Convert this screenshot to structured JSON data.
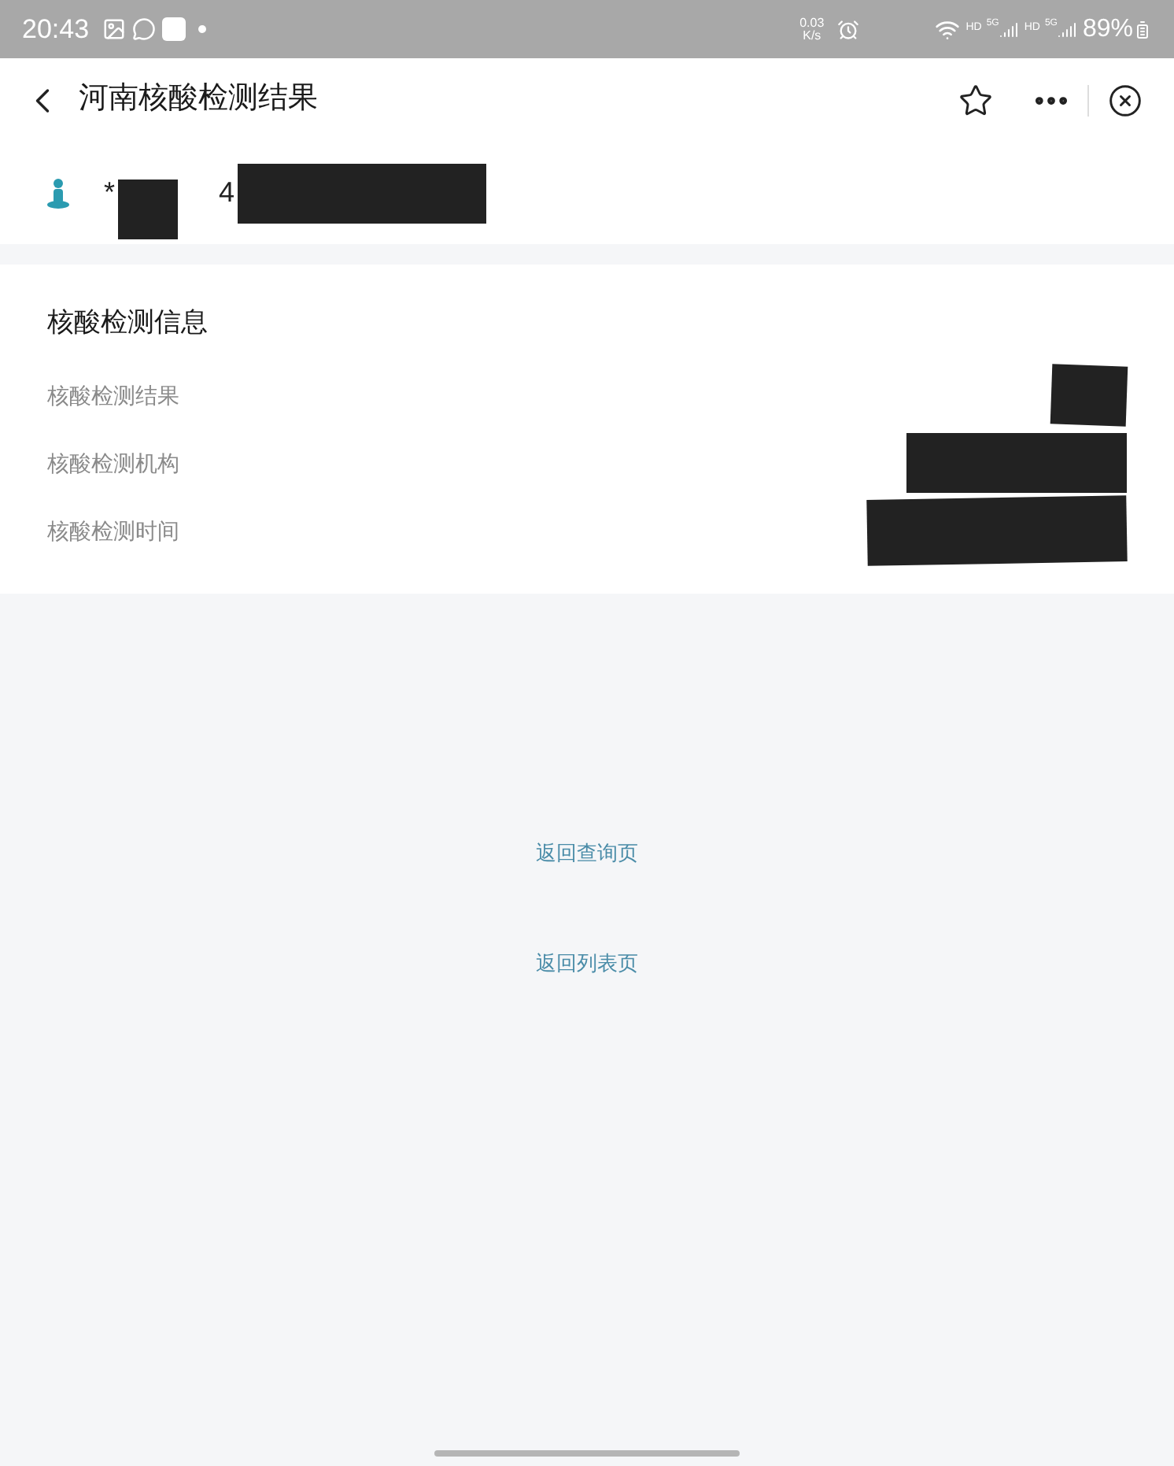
{
  "status_bar": {
    "time": "20:43",
    "net_speed_value": "0.03",
    "net_speed_unit": "K/s",
    "hd_1": "HD",
    "net_1": "5G",
    "hd_2": "HD",
    "net_2": "5G",
    "battery": "89%"
  },
  "header": {
    "title": "河南核酸检测结果"
  },
  "user": {
    "name_start": "*",
    "id_start": "4"
  },
  "info": {
    "title": "核酸检测信息",
    "rows": [
      {
        "label": "核酸检测结果"
      },
      {
        "label": "核酸检测机构"
      },
      {
        "label": "核酸检测时间"
      }
    ]
  },
  "links": [
    "返回查询页",
    "返回列表页"
  ]
}
